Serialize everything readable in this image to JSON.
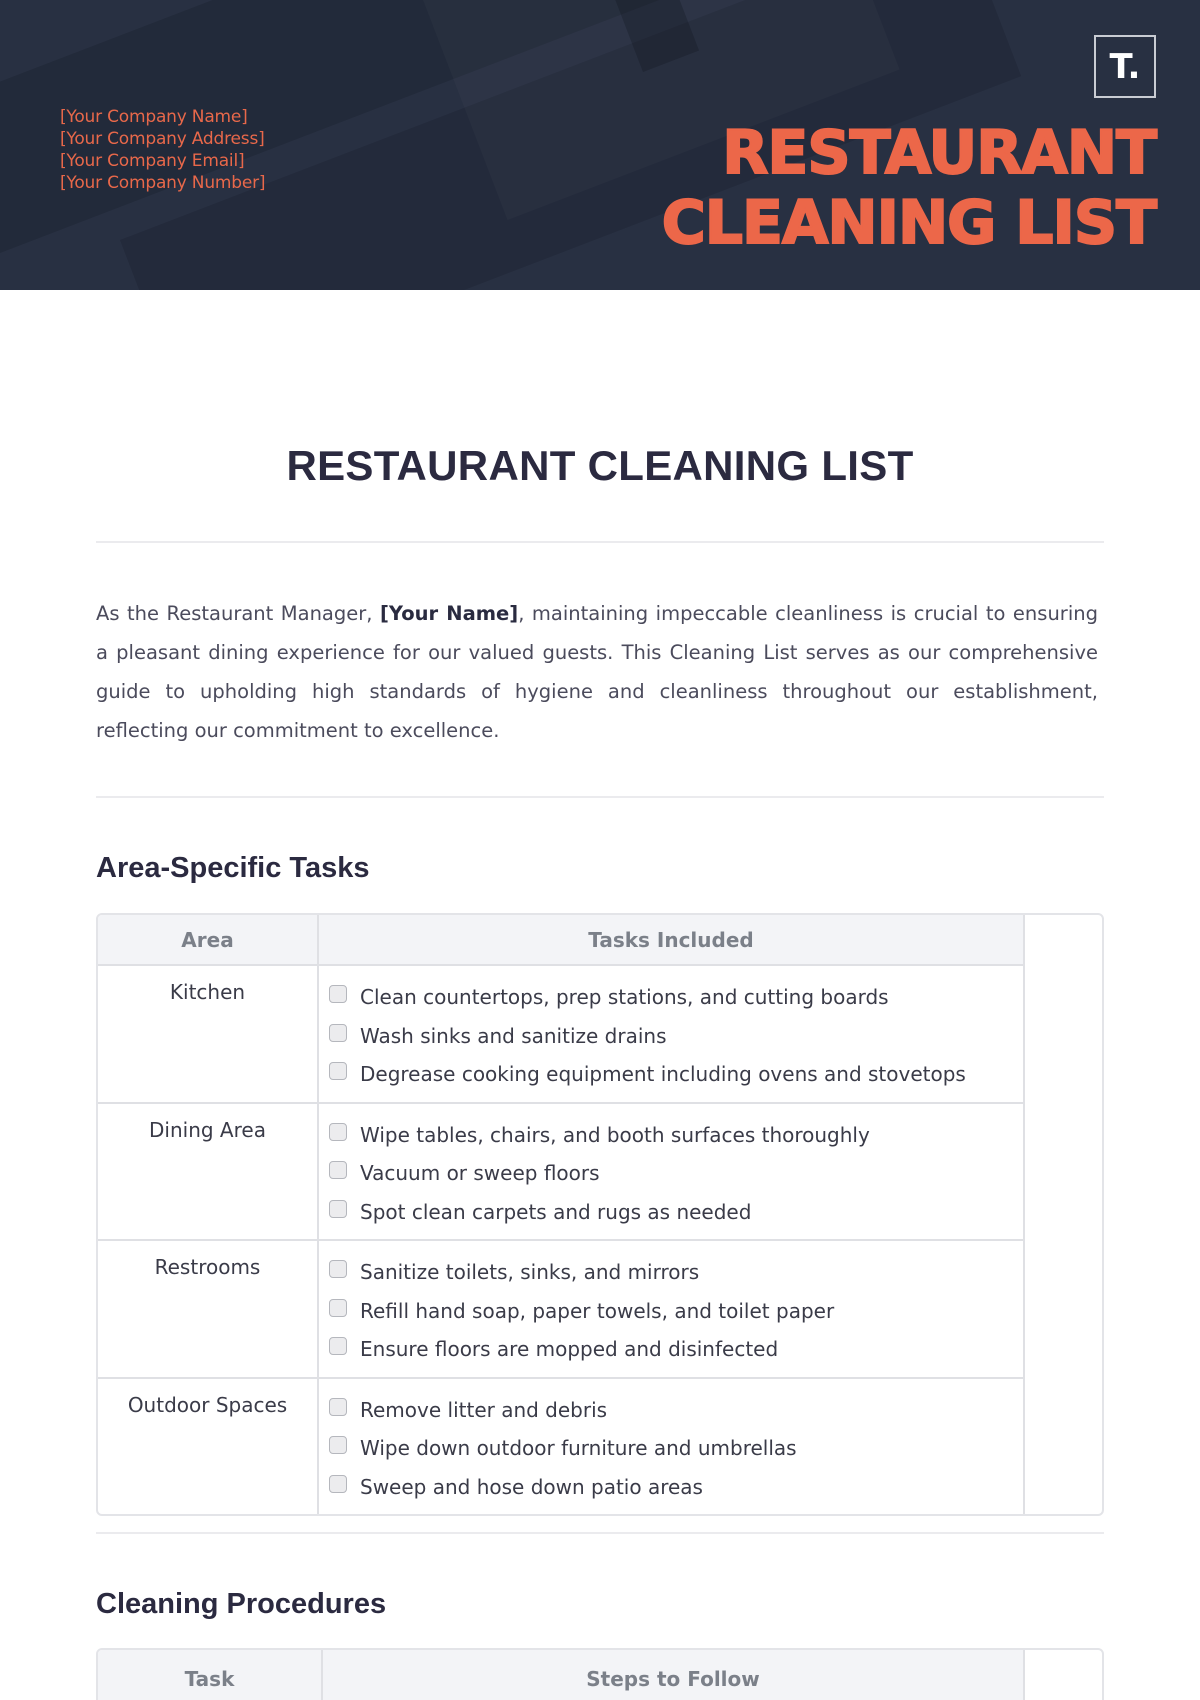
{
  "header": {
    "company_lines": [
      "[Your Company Name]",
      "[Your Company Address]",
      "[Your Company Email]",
      "[Your Company Number]"
    ],
    "logo_text": "T.",
    "title_lines": [
      "RESTAURANT",
      "CLEANING LIST"
    ],
    "accent_color": "#ec6749",
    "background_color": "#283042"
  },
  "document": {
    "title": "RESTAURANT CLEANING LIST",
    "intro": {
      "before": "As the Restaurant Manager, ",
      "bold": "[Your Name]",
      "after": ", maintaining impeccable cleanliness is crucial to ensuring a pleasant dining experience for our valued guests. This Cleaning List serves as our comprehensive guide to upholding high standards of hygiene and cleanliness throughout our establishment, reflecting our commitment to excellence."
    }
  },
  "area_tasks": {
    "heading": "Area-Specific Tasks",
    "columns": [
      "Area",
      "Tasks Included"
    ],
    "rows": [
      {
        "area": "Kitchen",
        "tasks": [
          "Clean countertops, prep stations, and cutting boards",
          "Wash sinks and sanitize drains",
          "Degrease cooking equipment including ovens and stovetops"
        ]
      },
      {
        "area": "Dining Area",
        "tasks": [
          "Wipe tables, chairs, and booth surfaces thoroughly",
          "Vacuum or sweep floors",
          "Spot clean carpets and rugs as needed"
        ]
      },
      {
        "area": "Restrooms",
        "tasks": [
          "Sanitize toilets, sinks, and mirrors",
          "Refill hand soap, paper towels, and toilet paper",
          "Ensure floors are mopped and disinfected"
        ]
      },
      {
        "area": "Outdoor Spaces",
        "tasks": [
          "Remove litter and debris",
          "Wipe down outdoor furniture and umbrellas",
          "Sweep and hose down patio areas"
        ]
      }
    ]
  },
  "procedures": {
    "heading": "Cleaning Procedures",
    "columns": [
      "Task",
      "Steps to Follow"
    ]
  }
}
